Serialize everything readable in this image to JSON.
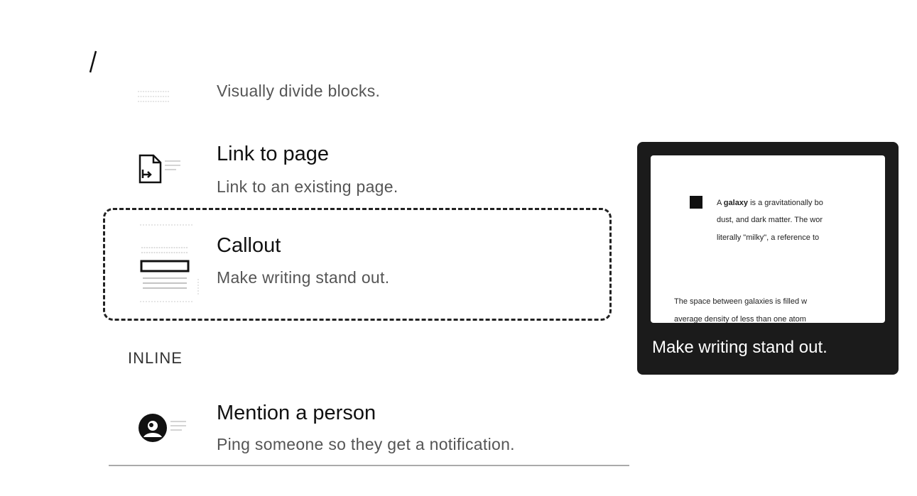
{
  "command": {
    "slash": "/"
  },
  "menu": {
    "items": [
      {
        "id": "divider",
        "description": "Visually divide blocks."
      },
      {
        "id": "link-to-page",
        "title": "Link to page",
        "description": "Link to an existing page."
      },
      {
        "id": "callout",
        "title": "Callout",
        "description": "Make writing stand out.",
        "selected": true
      }
    ],
    "section_inline": "INLINE",
    "inline_items": [
      {
        "id": "mention",
        "title": "Mention a person",
        "description": "Ping someone so they get a notification."
      }
    ]
  },
  "preview": {
    "line1_prefix": "A ",
    "line1_bold": "galaxy",
    "line1_rest": " is a gravitationally bo",
    "line2": "dust, and dark matter. The wor",
    "line3": "literally \"milky\", a reference to",
    "line4": "The space between galaxies is filled w",
    "line5": "average density of less than one atom",
    "caption": "Make writing stand out."
  },
  "colors": {
    "preview_bg": "#1b1b1b",
    "selection_border": "#222222"
  }
}
